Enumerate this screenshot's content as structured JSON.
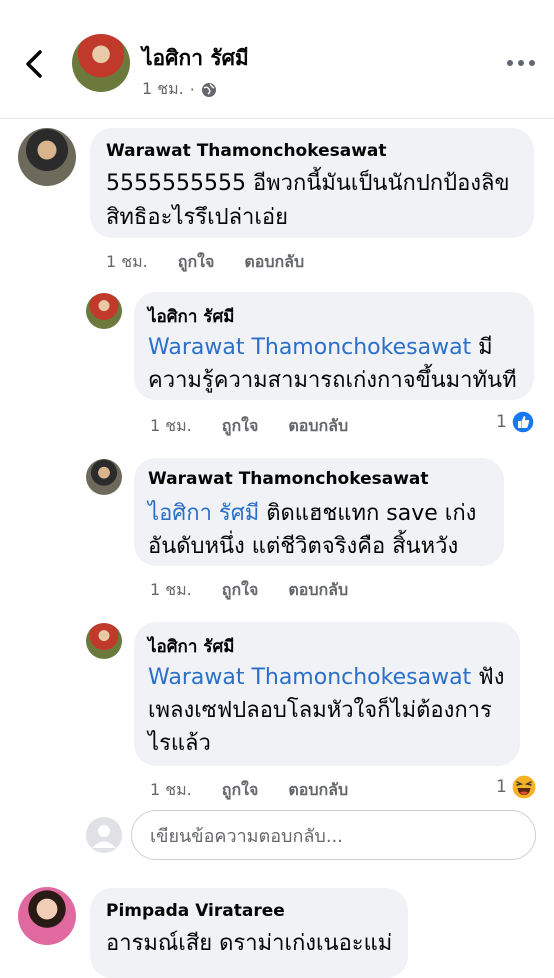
{
  "header": {
    "back_label": "back",
    "post_author": "ไอศิกา รัศมี",
    "post_time": "1 ชม.",
    "separator": "·"
  },
  "comments": [
    {
      "author": "Warawat Thamonchokesawat",
      "lines": [
        "5555555555 อีพวกนี้มันเป็นนักปกป้องลิข",
        "สิทธิอะไรรึเปล่าเอ่ย"
      ],
      "time": "1 ชม.",
      "like": "ถูกใจ",
      "reply": "ตอบกลับ"
    },
    {
      "author": "ไอศิกา รัศมี",
      "mention": "Warawat Thamonchokesawat",
      "line1_rest": " มี",
      "line2": "ความรู้ความสามารถเก่งกาจขึ้นมาทันที",
      "time": "1 ชม.",
      "like": "ถูกใจ",
      "reply": "ตอบกลับ",
      "reaction_count": "1",
      "reaction_icon": "like-icon"
    },
    {
      "author": "Warawat Thamonchokesawat",
      "mention": "ไอศิกา รัศมี",
      "line1_rest": "  ติดแฮชแทก save เก่ง",
      "line2": "อันดับหนึ่ง แต่ชีวิตจริงคือ สิ้นหวัง",
      "time": "1 ชม.",
      "like": "ถูกใจ",
      "reply": "ตอบกลับ"
    },
    {
      "author": "ไอศิกา รัศมี",
      "mention": "Warawat Thamonchokesawat",
      "line1_rest": " ฟัง",
      "line2": "เพลงเซฟปลอบโลมหัวใจก็ไม่ต้องการ",
      "line3": "ไรแล้ว",
      "time": "1 ชม.",
      "like": "ถูกใจ",
      "reply": "ตอบกลับ",
      "reaction_count": "1",
      "reaction_icon": "haha-icon"
    },
    {
      "author": "Pimpada Virataree",
      "text": "อารมณ์เสีย ดราม่าเก่งเนอะแม่"
    }
  ],
  "reply_box": {
    "placeholder": "เขียนข้อความตอบกลับ..."
  },
  "colors": {
    "accent": "#2a6fc9",
    "bubble": "#f0f2f5",
    "like_blue": "#1877f2",
    "haha_yellow": "#f7b125"
  }
}
